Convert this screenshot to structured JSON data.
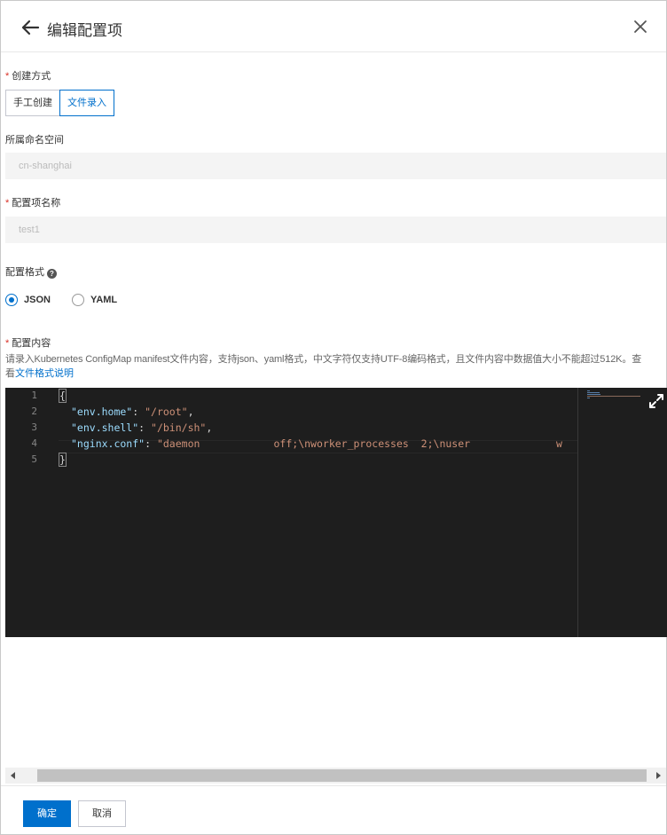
{
  "header": {
    "title": "编辑配置项"
  },
  "creation_method": {
    "label": "创建方式",
    "required_mark": "*",
    "options": [
      "手工创建",
      "文件录入"
    ],
    "selected": "文件录入"
  },
  "namespace": {
    "label": "所属命名空间",
    "value": "cn-shanghai"
  },
  "config_name": {
    "label": "配置项名称",
    "required_mark": "*",
    "value": "test1"
  },
  "config_format": {
    "label": "配置格式",
    "help_icon": "question-circle-icon",
    "help_glyph": "?",
    "options": [
      "JSON",
      "YAML"
    ],
    "selected": "JSON"
  },
  "config_content": {
    "label": "配置内容",
    "required_mark": "*",
    "description_line1": "请录入Kubernetes ConfigMap manifest文件内容，支持json、yaml格式，中文字符仅支持UTF-8编码格式，且文件内容中数据值大小不能超过512K。查",
    "description_line2_prefix": "看",
    "description_link": "文件格式说明"
  },
  "editor": {
    "line_numbers": [
      "1",
      "2",
      "3",
      "4",
      "5"
    ],
    "lines": [
      {
        "text": "{"
      },
      {
        "key": "\"env.home\"",
        "sep": ": ",
        "value": "\"/root\"",
        "end": ","
      },
      {
        "key": "\"env.shell\"",
        "sep": ": ",
        "value": "\"/bin/sh\"",
        "end": ","
      },
      {
        "key": "\"nginx.conf\"",
        "sep": ": ",
        "value": "\"daemon            off;\\nworker_processes  2;\\nuser              w",
        "end": ""
      },
      {
        "text": "}"
      }
    ],
    "expand_icon": "expand-icon"
  },
  "footer": {
    "confirm_label": "确定",
    "cancel_label": "取消"
  },
  "colors": {
    "accent": "#0070cc",
    "required": "#d93026",
    "editor_bg": "#1e1e1e",
    "json_key": "#9cdcfe",
    "json_string": "#ce9178"
  }
}
